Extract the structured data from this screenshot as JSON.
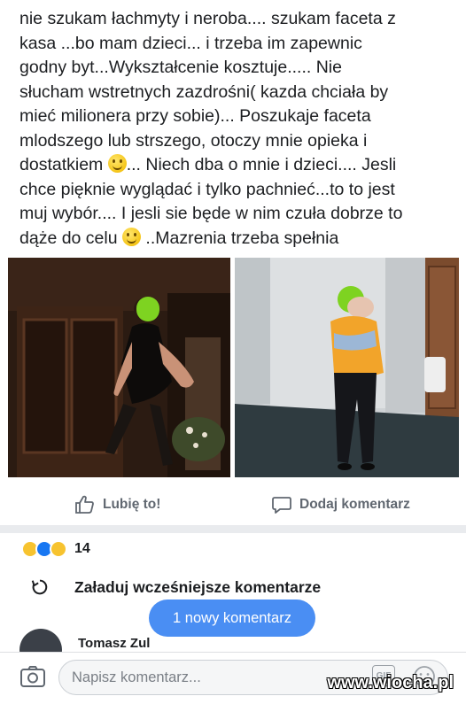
{
  "post": {
    "lines": [
      "nie szukam łachmyty i neroba.... szukam faceta z",
      "kasa ...bo mam dzieci... i trzeba im zapewnic",
      "godny byt...Wykształcenie kosztuje..... Nie",
      "słucham wstretnych zazdrośni( kazda chciała by",
      "mieć milionera przy sobie)... Poszukaje faceta",
      "mlodszego lub strszego, otoczy mnie opieka i",
      "dostatkiem",
      "... Niech dba o mnie i dzieci.... Jesli",
      "chce pięknie wyglądać i tylko pachnieć...to to jest",
      "muj wybór.... I jesli sie będe w nim czuła dobrze to",
      "dąże do celu",
      " ..Mazrenia trzeba spełnia"
    ],
    "emoji": "smiling-face-emoji"
  },
  "actions": {
    "like_label": "Lubię to!",
    "comment_label": "Dodaj komentarz"
  },
  "reactions": {
    "types": [
      "haha",
      "like",
      "wow"
    ],
    "count": "14"
  },
  "comments": {
    "load_earlier_label": "Załaduj wcześniejsze komentarze",
    "new_comment_pill": "1 nowy komentarz",
    "partial_commenter_name": "Tomasz Zul"
  },
  "composer": {
    "placeholder": "Napisz komentarz..."
  },
  "watermark": "www.wiocha.pl",
  "colors": {
    "accent_blue": "#4a8ef3",
    "like_blue": "#1877f2",
    "divider_gray": "#e9ebee",
    "muted_text": "#606770"
  }
}
